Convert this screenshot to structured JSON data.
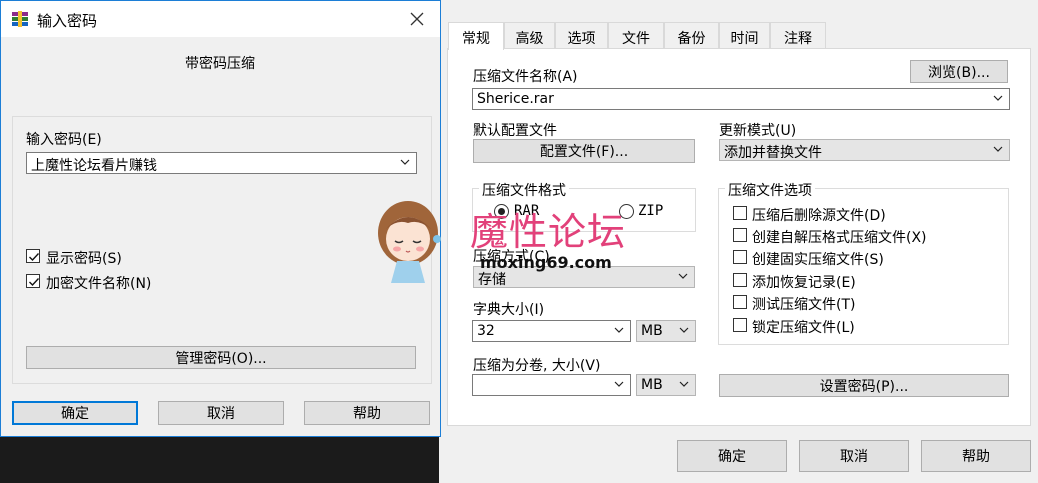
{
  "main_dialog": {
    "tabs": [
      {
        "label": "常规",
        "active": true
      },
      {
        "label": "高级"
      },
      {
        "label": "选项"
      },
      {
        "label": "文件"
      },
      {
        "label": "备份"
      },
      {
        "label": "时间"
      },
      {
        "label": "注释"
      }
    ],
    "archive_name_label": "压缩文件名称(A)",
    "browse_button": "浏览(B)...",
    "archive_name_value": "Sherice.rar",
    "default_profile_label": "默认配置文件",
    "profiles_button": "配置文件(F)...",
    "update_mode_label": "更新模式(U)",
    "update_mode_value": "添加并替换文件",
    "format_group_title": "压缩文件格式",
    "format_rar": "RAR",
    "format_zip": "ZIP",
    "format_selected": "RAR",
    "method_label": "压缩方式(C)",
    "method_value": "存储",
    "dict_label": "字典大小(I)",
    "dict_value": "32",
    "dict_unit": "MB",
    "split_label": "压缩为分卷, 大小(V)",
    "split_value": "",
    "split_unit": "MB",
    "options_group_title": "压缩文件选项",
    "options": [
      {
        "label": "压缩后删除源文件(D)",
        "checked": false
      },
      {
        "label": "创建自解压格式压缩文件(X)",
        "checked": false
      },
      {
        "label": "创建固实压缩文件(S)",
        "checked": false
      },
      {
        "label": "添加恢复记录(E)",
        "checked": false
      },
      {
        "label": "测试压缩文件(T)",
        "checked": false
      },
      {
        "label": "锁定压缩文件(L)",
        "checked": false
      }
    ],
    "set_password_button": "设置密码(P)...",
    "ok_button": "确定",
    "cancel_button": "取消",
    "help_button": "帮助"
  },
  "password_dialog": {
    "title": "输入密码",
    "heading": "带密码压缩",
    "password_label": "输入密码(E)",
    "password_value": "上魔性论坛看片赚钱",
    "show_password_label": "显示密码(S)",
    "show_password_checked": true,
    "encrypt_names_label": "加密文件名称(N)",
    "encrypt_names_checked": true,
    "organize_button": "管理密码(O)...",
    "ok_button": "确定",
    "cancel_button": "取消",
    "help_button": "帮助"
  },
  "watermark": {
    "text": "魔性论坛",
    "url": "moxing69.com"
  },
  "colors": {
    "accent": "#0078d7",
    "watermark": "#e2417a"
  }
}
